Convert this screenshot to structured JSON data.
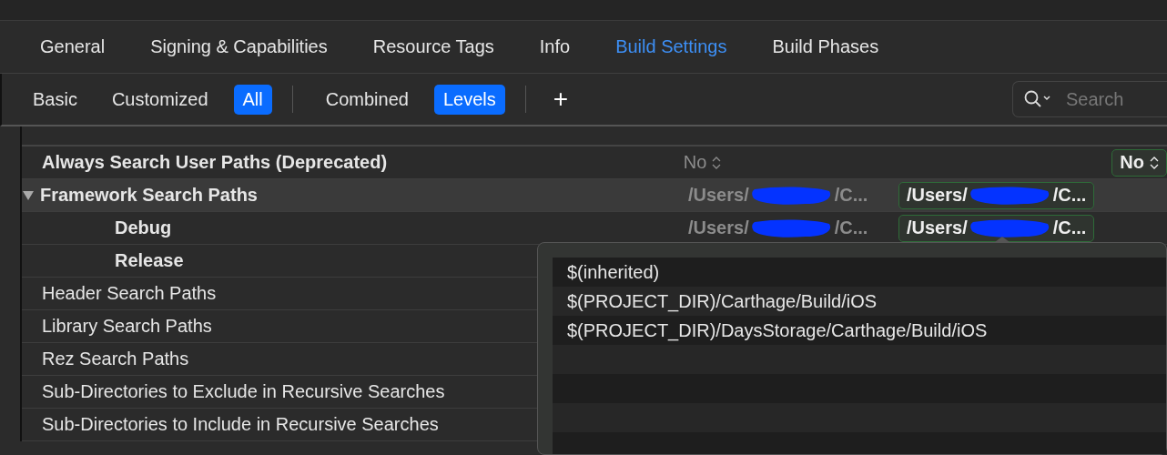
{
  "tabs": [
    {
      "label": "General",
      "selected": false
    },
    {
      "label": "Signing & Capabilities",
      "selected": false
    },
    {
      "label": "Resource Tags",
      "selected": false
    },
    {
      "label": "Info",
      "selected": false
    },
    {
      "label": "Build Settings",
      "selected": true
    },
    {
      "label": "Build Phases",
      "selected": false
    }
  ],
  "scope_filters": [
    {
      "label": "Basic",
      "selected": false
    },
    {
      "label": "Customized",
      "selected": false
    },
    {
      "label": "All",
      "selected": true
    }
  ],
  "view_filters": [
    {
      "label": "Combined",
      "selected": false
    },
    {
      "label": "Levels",
      "selected": true
    }
  ],
  "add_button": "+",
  "search": {
    "placeholder": "Search"
  },
  "rows": [
    {
      "setting": "Always Search User Paths (Deprecated)",
      "bold": true,
      "resolved": {
        "kind": "choice",
        "text": "No",
        "defined": false
      },
      "column_4": {
        "kind": "choice",
        "text": "No",
        "defined": true
      }
    },
    {
      "setting": "Framework Search Paths",
      "bold": true,
      "expanded": true,
      "selected": true,
      "resolved": {
        "kind": "path",
        "prefix": "/Users/",
        "suffix": "/C...",
        "defined": false
      },
      "days": {
        "kind": "path",
        "prefix": "/Users/",
        "suffix": "/C...",
        "defined": true
      },
      "children": [
        {
          "setting": "Debug",
          "bold": true,
          "resolved": {
            "kind": "path",
            "prefix": "/Users/",
            "suffix": "/C...",
            "defined": false
          },
          "days": {
            "kind": "path",
            "prefix": "/Users/",
            "suffix": "/C...",
            "defined": true
          }
        },
        {
          "setting": "Release",
          "bold": true
        }
      ]
    },
    {
      "setting": "Header Search Paths",
      "bold": false
    },
    {
      "setting": "Library Search Paths",
      "bold": false
    },
    {
      "setting": "Rez Search Paths",
      "bold": false
    },
    {
      "setting": "Sub-Directories to Exclude in Recursive Searches",
      "bold": false
    },
    {
      "setting": "Sub-Directories to Include in Recursive Searches",
      "bold": false
    }
  ],
  "popover": {
    "items": [
      "$(inherited)",
      "$(PROJECT_DIR)/Carthage/Build/iOS",
      "$(PROJECT_DIR)/DaysStorage/Carthage/Build/iOS"
    ]
  }
}
